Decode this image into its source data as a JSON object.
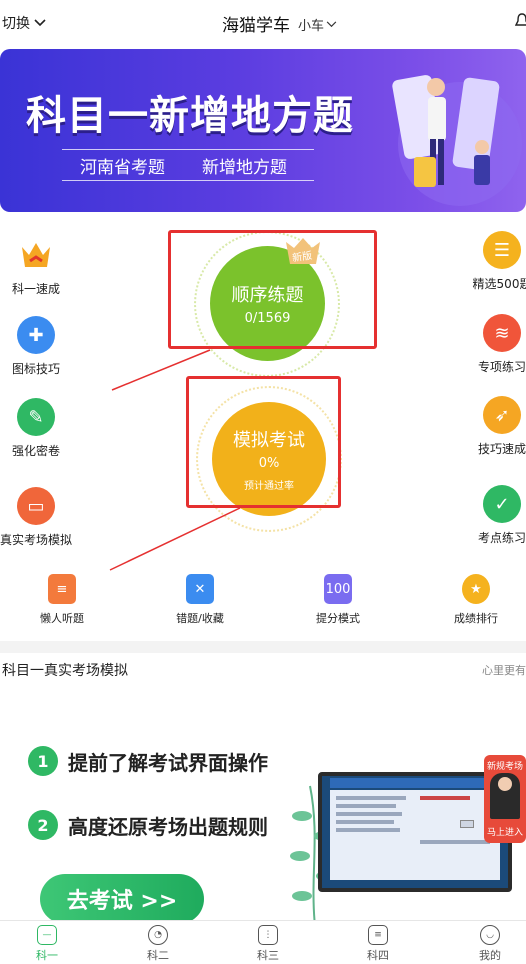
{
  "header": {
    "switch_label": "切换",
    "title": "海猫学车",
    "car_type": "小车"
  },
  "banner": {
    "title": "科目一新增地方题",
    "subtitle_left": "河南省考题",
    "subtitle_right": "新增地方题"
  },
  "left_menu": [
    {
      "label": "科一速成",
      "icon": "crown-icon",
      "color": "#f5a623"
    },
    {
      "label": "图标技巧",
      "icon": "puzzle-icon",
      "color": "#3b8cf0"
    },
    {
      "label": "强化密卷",
      "icon": "scroll-icon",
      "color": "#2fb864"
    },
    {
      "label": "真实考场模拟",
      "icon": "monitor-icon",
      "color": "#f0663a"
    }
  ],
  "right_menu": [
    {
      "label": "精选500题",
      "icon": "list-icon",
      "color": "#f5b21e"
    },
    {
      "label": "专项练习",
      "icon": "layers-icon",
      "color": "#f0553a"
    },
    {
      "label": "技巧速成",
      "icon": "rocket-icon",
      "color": "#f5a623"
    },
    {
      "label": "考点练习",
      "icon": "doc-icon",
      "color": "#2fb864"
    }
  ],
  "practice": {
    "title": "顺序练题",
    "progress": "0/1569",
    "badge": "新版",
    "color": "#7bc22c"
  },
  "exam": {
    "title": "模拟考试",
    "pass_rate": "0%",
    "pass_label": "预计通过率",
    "color": "#f2b11a"
  },
  "bottom_row": [
    {
      "label": "懒人听题",
      "icon": "headphone-doc-icon",
      "color": "#f37a3c"
    },
    {
      "label": "错题/收藏",
      "icon": "notebook-icon",
      "color": "#3b8cf0"
    },
    {
      "label": "提分模式",
      "icon": "score-book-icon",
      "color": "#7a6cf0"
    },
    {
      "label": "成绩排行",
      "icon": "medal-icon",
      "color": "#f5b21e"
    }
  ],
  "section": {
    "title": "科目一真实考场模拟",
    "more": "心里更有"
  },
  "promo": {
    "bullet1_num": "1",
    "bullet1": "提前了解考试界面操作",
    "bullet2_num": "2",
    "bullet2": "高度还原考场出题规则",
    "button": "去考试 >>",
    "card_top": "新规考场",
    "card_bottom": "马上进入"
  },
  "tabs": [
    {
      "label": "科一",
      "active": true
    },
    {
      "label": "科二",
      "active": false
    },
    {
      "label": "科三",
      "active": false
    },
    {
      "label": "科四",
      "active": false
    },
    {
      "label": "我的",
      "active": false
    }
  ]
}
